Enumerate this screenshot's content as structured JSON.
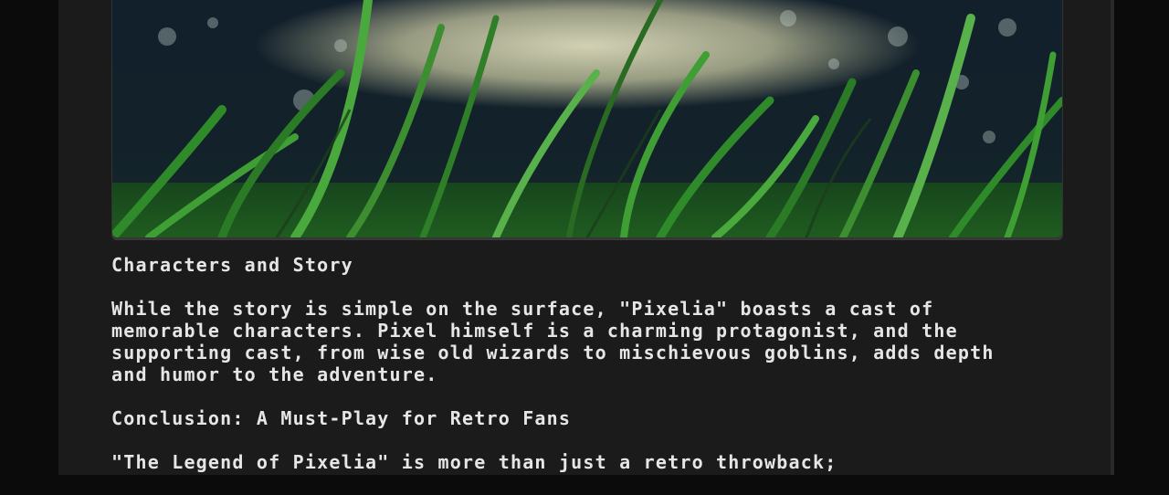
{
  "article": {
    "hero_image": {
      "icon": "grass-photo",
      "colors": {
        "grass": "#2f8a2a",
        "sky": "#d9d6b8",
        "shadow": "#0f1d2a"
      }
    },
    "section_heading": "Characters and Story",
    "section_paragraph": "While the story is simple on the surface, \"Pixelia\" boasts a cast of memorable characters. Pixel himself is a charming protagonist, and the supporting cast, from wise old wizards to mischievous goblins, adds depth and humor to the adventure.",
    "conclusion_heading": "Conclusion: A Must-Play for Retro Fans",
    "conclusion_paragraph_start": "\"The Legend of Pixelia\" is more than just a retro throwback;"
  }
}
